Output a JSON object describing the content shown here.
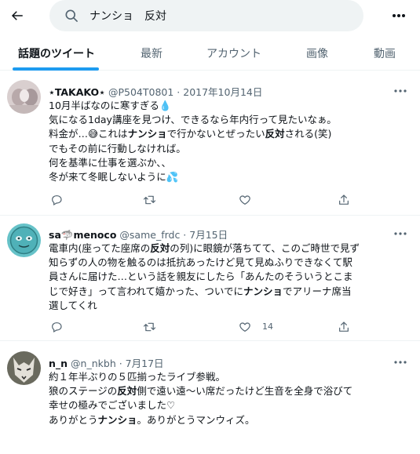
{
  "search": {
    "query": "ナンショ　反対"
  },
  "tabs": [
    {
      "label": "話題のツイート",
      "active": true
    },
    {
      "label": "最新",
      "active": false
    },
    {
      "label": "アカウント",
      "active": false
    },
    {
      "label": "画像",
      "active": false
    },
    {
      "label": "動画",
      "active": false
    }
  ],
  "colors": {
    "accent": "#1d9bf0",
    "text": "#0f1419",
    "secondary": "#536471",
    "divider": "#eff3f4"
  },
  "tweets": [
    {
      "name": "⋆TAKAKO⋆",
      "meta": "@P504T0801 · 2017年10月14日",
      "lines": [
        [
          "10月半ばなのに寒すぎる",
          "💧"
        ],
        [
          "気になる1day講座を見つけ、できるなら年内行って見たいなぁ。"
        ],
        [
          "料金が…",
          "😅",
          "これは",
          "ナンショ",
          "で行かないとぜったい",
          "反対",
          "される(笑)"
        ],
        [
          "でもその前に行動しなければ。"
        ],
        [
          "何を基準に仕事を選ぶか、、"
        ],
        [
          "冬が来て冬眠しないように",
          "💦"
        ]
      ],
      "counts": {
        "reply": "",
        "retweet": "",
        "like": ""
      }
    },
    {
      "name": "sa🦈menoco",
      "meta": "@same_frdc · 7月15日",
      "lines": [
        [
          "電車内(座ってた座席の",
          "反対",
          "の列)に眼鏡が落ちてて、このご時世で見ず"
        ],
        [
          "知らずの人の物を触るのは抵抗あったけど見て見ぬふりできなくて駅"
        ],
        [
          "員さんに届けた…という話を親友にしたら「あんたのそういうとこま"
        ],
        [
          "じで好き」って言われて嬉かった、ついでに",
          "ナンショ",
          "でアリーナ席当"
        ],
        [
          "選してくれ"
        ]
      ],
      "counts": {
        "reply": "",
        "retweet": "",
        "like": "14"
      }
    },
    {
      "name": "n_n",
      "meta": "@n_nkbh · 7月17日",
      "lines": [
        [
          "約１年半ぶりの５匹揃ったライブ参戦。"
        ],
        [
          "狼のステージの",
          "反対",
          "側で遠い遠〜い席だったけど生音を全身で浴びて"
        ],
        [
          "幸せの極みでございました♡"
        ],
        [
          "ありがとう",
          "ナンショ",
          "。ありがとうマンウィズ。"
        ]
      ],
      "counts": {
        "reply": "",
        "retweet": "",
        "like": ""
      }
    }
  ]
}
